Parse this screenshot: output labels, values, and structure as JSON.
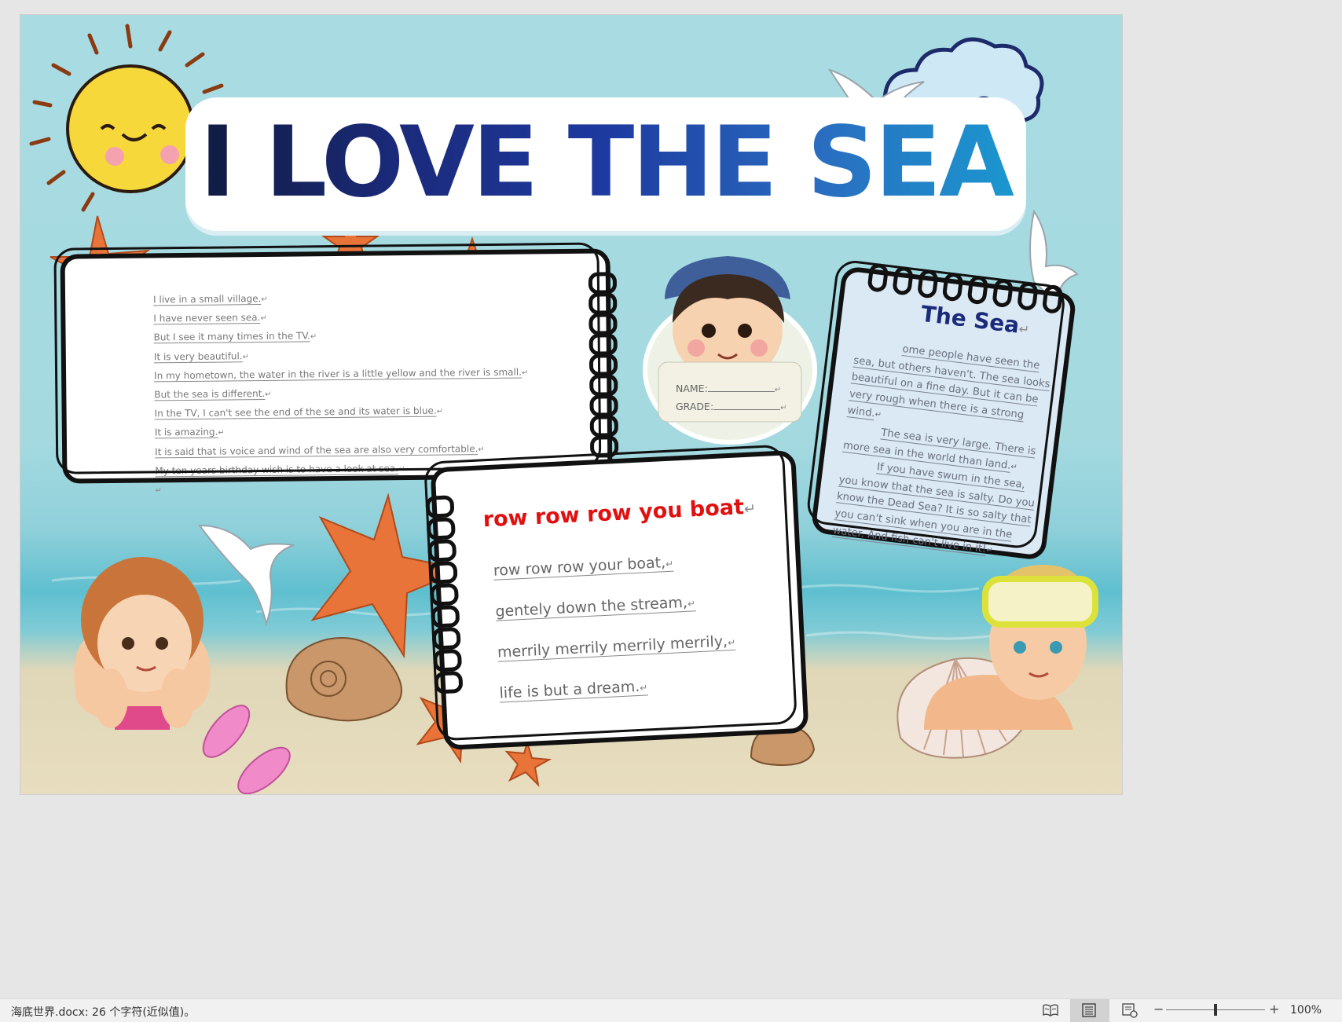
{
  "poster": {
    "title": "I LOVE THE SEA",
    "story_lines": [
      "I live in a small village.",
      "I have never seen sea.",
      "But I see it many times in the TV.",
      "It is very beautiful.",
      "In my hometown, the water in the river is a little yellow and the river is small.",
      "But the sea is different.",
      "In the TV, I can't see the end of the se and its water is blue.",
      "It is amazing.",
      "It is said that is voice and wind of the sea are also very comfortable.",
      "My ten years birthday wish is to have a look at sea."
    ],
    "paragraph_mark": "↵",
    "badge": {
      "name_label": "NAME:",
      "grade_label": "GRADE:"
    },
    "song": {
      "title": "row row row you boat",
      "lines": [
        "row row row your boat,",
        "gentely down the stream,",
        "merrily merrily merrily merrily,",
        "life is but a dream."
      ]
    },
    "sea_card": {
      "title": "The Sea",
      "paragraphs": [
        "ome people have seen the sea, but others haven't. The sea looks beautiful on a fine day. But it can be very rough when there is a strong wind.",
        "The sea is very large. There is more sea in the world than land.",
        "If you have swum in the sea, you know that the sea is salty. Do you know the Dead Sea? It is so salty that you can't sink when you are in the water. And fish can't live in it!"
      ]
    }
  },
  "statusbar": {
    "doc_status": "海底世界.docx: 26 个字符(近似值)。",
    "zoom_out": "−",
    "zoom_in": "+",
    "zoom_level": "100%",
    "zoom_fraction": 0.5
  },
  "colors": {
    "title_dark": "#101b3d",
    "title_light": "#1a9ad0",
    "song_title": "#e01010",
    "starfish": "#e8743a",
    "sun": "#f6d83a"
  }
}
